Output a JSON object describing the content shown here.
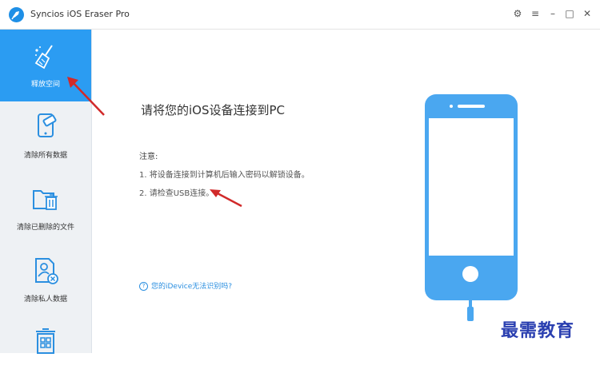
{
  "window": {
    "title": "Syncios iOS Eraser Pro"
  },
  "title_controls": [
    {
      "name": "settings-gear-icon",
      "glyph": "⚙"
    },
    {
      "name": "menu-icon",
      "glyph": "≡"
    },
    {
      "name": "minimize-icon",
      "glyph": "–"
    },
    {
      "name": "maximize-icon",
      "glyph": "□"
    },
    {
      "name": "close-icon",
      "glyph": "✕"
    }
  ],
  "sidebar": {
    "items": [
      {
        "label": "释放空间",
        "icon": "broom-sparkle-icon",
        "active": true
      },
      {
        "label": "清除所有数据",
        "icon": "phone-eraser-icon",
        "active": false
      },
      {
        "label": "清除已删除的文件",
        "icon": "folder-trash-icon",
        "active": false
      },
      {
        "label": "清除私人数据",
        "icon": "user-doc-delete-icon",
        "active": false
      },
      {
        "label": "",
        "icon": "apps-trash-icon",
        "active": false
      }
    ]
  },
  "main": {
    "title": "请将您的iOS设备连接到PC",
    "notice_title": "注意:",
    "notice_lines": [
      "1. 将设备连接到计算机后输入密码以解锁设备。",
      "2. 请检查USB连接。"
    ],
    "help_link": "您的iDevice无法识别吗?"
  },
  "watermark": "最需教育",
  "colors": {
    "accent": "#2b9cf2",
    "phone": "#4aa7f0",
    "arrow": "#d12a2a",
    "watermark": "#2a3fb0"
  }
}
